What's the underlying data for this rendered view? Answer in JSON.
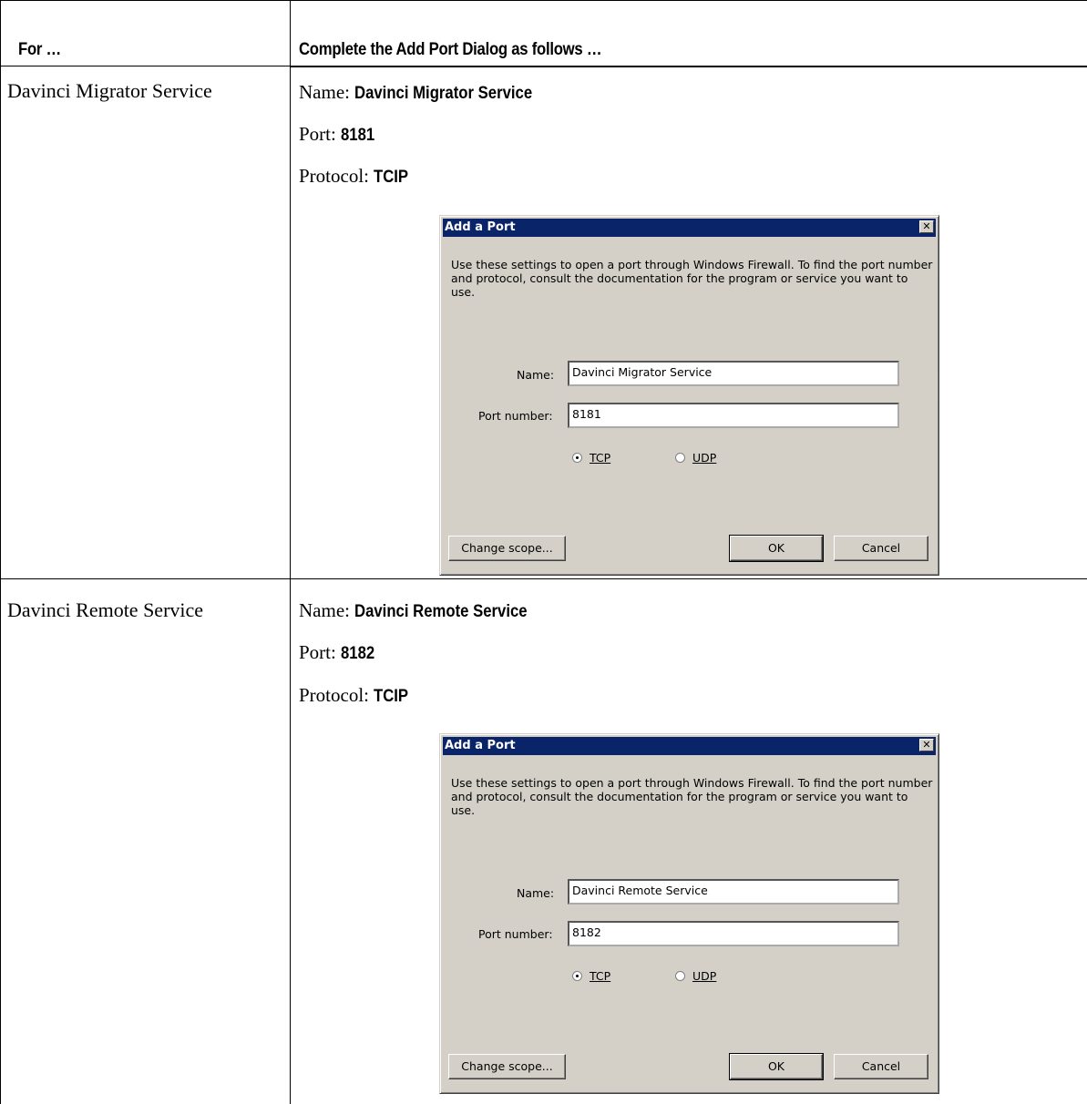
{
  "table": {
    "header": {
      "col1": "For …",
      "col2": "Complete the Add Port Dialog as follows …"
    },
    "rows": [
      {
        "service": "Davinci Migrator Service",
        "name_label": "Name:",
        "name_value": "Davinci Migrator Service",
        "port_label": "Port:",
        "port_value": "8181",
        "protocol_label": "Protocol:",
        "protocol_value": "TCIP",
        "dialog": {
          "title": "Add a Port",
          "close": "✕",
          "description": "Use these settings to open a port through Windows Firewall. To find the port number and protocol, consult the documentation for the program or service you want to use.",
          "name_field_label": "Name:",
          "name_field_value": "Davinci Migrator Service",
          "port_field_label": "Port number:",
          "port_field_value": "8181",
          "tcp_label": "TCP",
          "udp_label": "UDP",
          "selected_protocol": "TCP",
          "change_scope": "Change scope...",
          "ok": "OK",
          "cancel": "Cancel"
        }
      },
      {
        "service": "Davinci Remote Service",
        "name_label": "Name:",
        "name_value": "Davinci Remote Service",
        "port_label": "Port:",
        "port_value": "8182",
        "protocol_label": "Protocol:",
        "protocol_value": "TCIP",
        "dialog": {
          "title": "Add a Port",
          "close": "✕",
          "description": "Use these settings to open a port through Windows Firewall. To find the port number and protocol, consult the documentation for the program or service you want to use.",
          "name_field_label": "Name:",
          "name_field_value": "Davinci Remote Service",
          "port_field_label": "Port number:",
          "port_field_value": "8182",
          "tcp_label": "TCP",
          "udp_label": "UDP",
          "selected_protocol": "TCP",
          "change_scope": "Change scope...",
          "ok": "OK",
          "cancel": "Cancel"
        }
      }
    ]
  }
}
